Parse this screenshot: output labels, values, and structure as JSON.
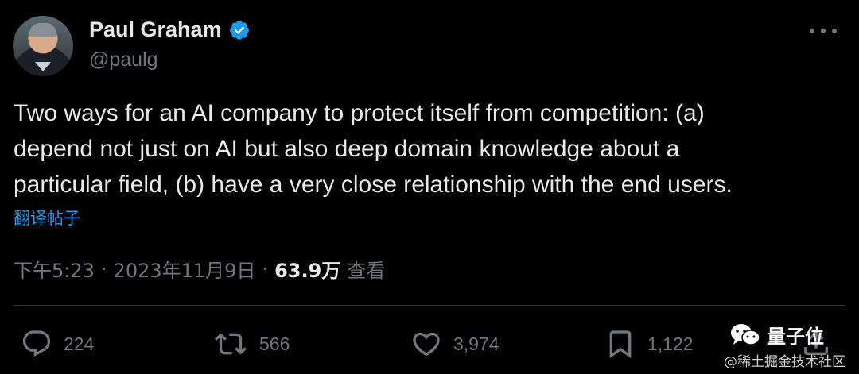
{
  "author": {
    "name": "Paul Graham",
    "handle": "@paulg",
    "verified_color": "#1d9bf0"
  },
  "tweet": {
    "lines": [
      "Two ways for an AI company to protect itself from competition: (a)",
      "depend not just on AI but also deep domain knowledge about a",
      "particular field, (b) have a very close relationship with the end users."
    ],
    "translate_label": "翻译帖子",
    "time": "下午5:23",
    "date": "2023年11月9日",
    "separator": "·",
    "views_count": "63.9万",
    "views_label": "查看"
  },
  "actions": {
    "replies": "224",
    "reposts": "566",
    "likes": "3,974",
    "bookmarks": "1,122"
  },
  "icons": {
    "verified": "verified-badge-icon",
    "more": "more-options-icon",
    "reply": "reply-icon",
    "repost": "repost-icon",
    "like": "heart-icon",
    "bookmark": "bookmark-icon",
    "share": "share-icon"
  },
  "watermark": {
    "brand": "量子位",
    "source": "@稀土掘金技术社区"
  },
  "colors": {
    "background": "#000000",
    "text_primary": "#e7e9ea",
    "text_secondary": "#71767b",
    "accent": "#1d9bf0",
    "divider": "#2f3336"
  }
}
